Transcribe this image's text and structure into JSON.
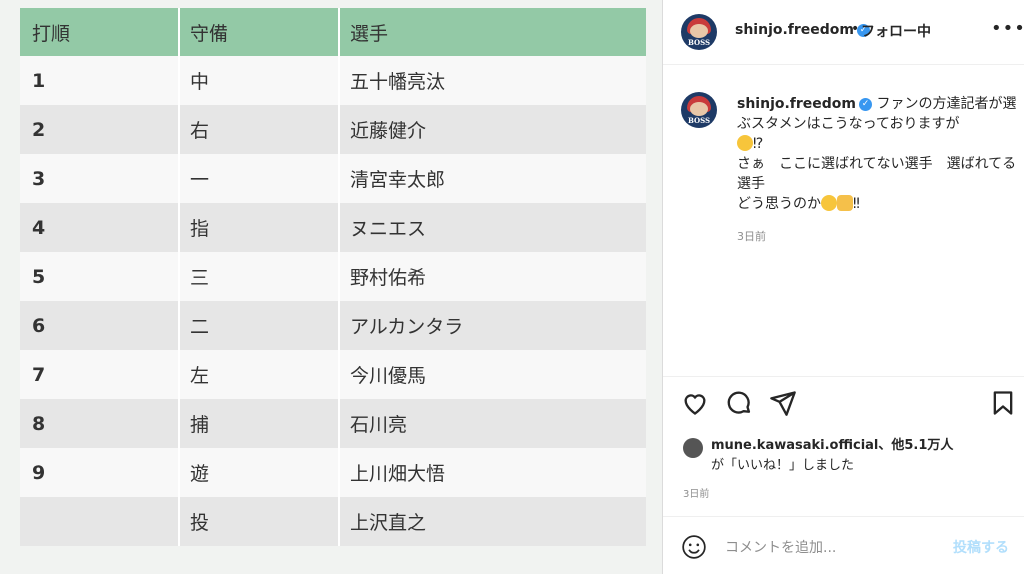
{
  "lineup": {
    "headers": [
      "打順",
      "守備",
      "選手"
    ],
    "rows": [
      {
        "order": "1",
        "pos": "中",
        "player": "五十幡亮汰"
      },
      {
        "order": "2",
        "pos": "右",
        "player": "近藤健介"
      },
      {
        "order": "3",
        "pos": "一",
        "player": "清宮幸太郎"
      },
      {
        "order": "4",
        "pos": "指",
        "player": "ヌニエス"
      },
      {
        "order": "5",
        "pos": "三",
        "player": "野村佑希"
      },
      {
        "order": "6",
        "pos": "二",
        "player": "アルカンタラ"
      },
      {
        "order": "7",
        "pos": "左",
        "player": "今川優馬"
      },
      {
        "order": "8",
        "pos": "捕",
        "player": "石川亮"
      },
      {
        "order": "9",
        "pos": "遊",
        "player": "上川畑大悟"
      },
      {
        "order": "",
        "pos": "投",
        "player": "上沢直之"
      }
    ]
  },
  "header": {
    "username": "shinjo.freedom",
    "separator": "•",
    "follow_status": "フォロー中",
    "more": "•••",
    "avatar_text": "BOSS"
  },
  "post": {
    "username": "shinjo.freedom",
    "caption_line1": "ファンの方達記者が選ぶスタメンはこうなっておりますが",
    "caption_mark": "⁉",
    "caption_line2": "さぁ　ここに選ばれてない選手　選ばれてる選手",
    "caption_line3": "どう思うのか",
    "caption_end": "‼",
    "time": "3日前"
  },
  "likes": {
    "user": "mune.kawasaki.official",
    "others": "、他5.1万人",
    "suffix": "が「いいね！」しました",
    "time": "3日前"
  },
  "comment": {
    "placeholder": "コメントを追加...",
    "post_label": "投稿する"
  },
  "colors": {
    "header_green": "#93c9a6",
    "verified": "#3897f0",
    "post_button": "#b2dffc"
  }
}
